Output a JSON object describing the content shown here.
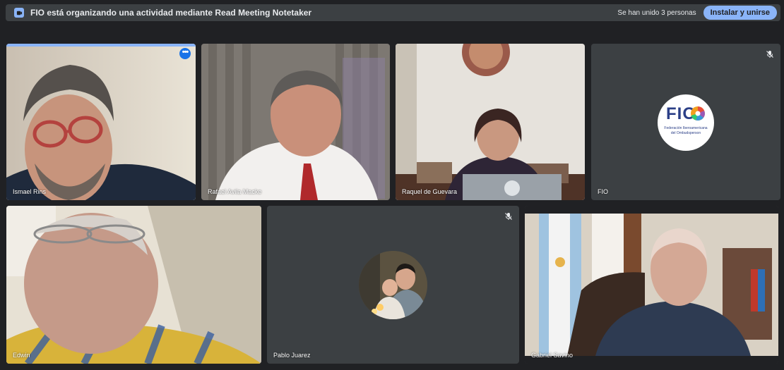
{
  "banner": {
    "icon": "meet-app-icon",
    "message": "FIO está organizando una actividad mediante Read Meeting Notetaker",
    "joined_text": "Se han unido 3 personas",
    "install_label": "Instalar y unirse",
    "accent": "#8ab4f8"
  },
  "participants": [
    {
      "name": "Ismael Rins",
      "active": true,
      "muted": false
    },
    {
      "name": "Rafael Avila Macke",
      "active": false,
      "muted": false
    },
    {
      "name": "Raquel de Guevara",
      "active": false,
      "muted": false
    },
    {
      "name": "FIO",
      "active": false,
      "muted": true
    },
    {
      "name": "Edwin",
      "active": false,
      "muted": false
    },
    {
      "name": "Pablo Juarez",
      "active": false,
      "muted": true
    },
    {
      "name": "Gabriel Savino",
      "active": false,
      "muted": false
    }
  ],
  "fio_logo": {
    "letters": "FIO",
    "line1": "Federación Iberoamericana",
    "line2": "del Ombudsperson"
  },
  "colors": {
    "background": "#202124",
    "tile": "#3c4043",
    "active_outline": "#8ab4f8",
    "more_button": "#1a73e8"
  }
}
